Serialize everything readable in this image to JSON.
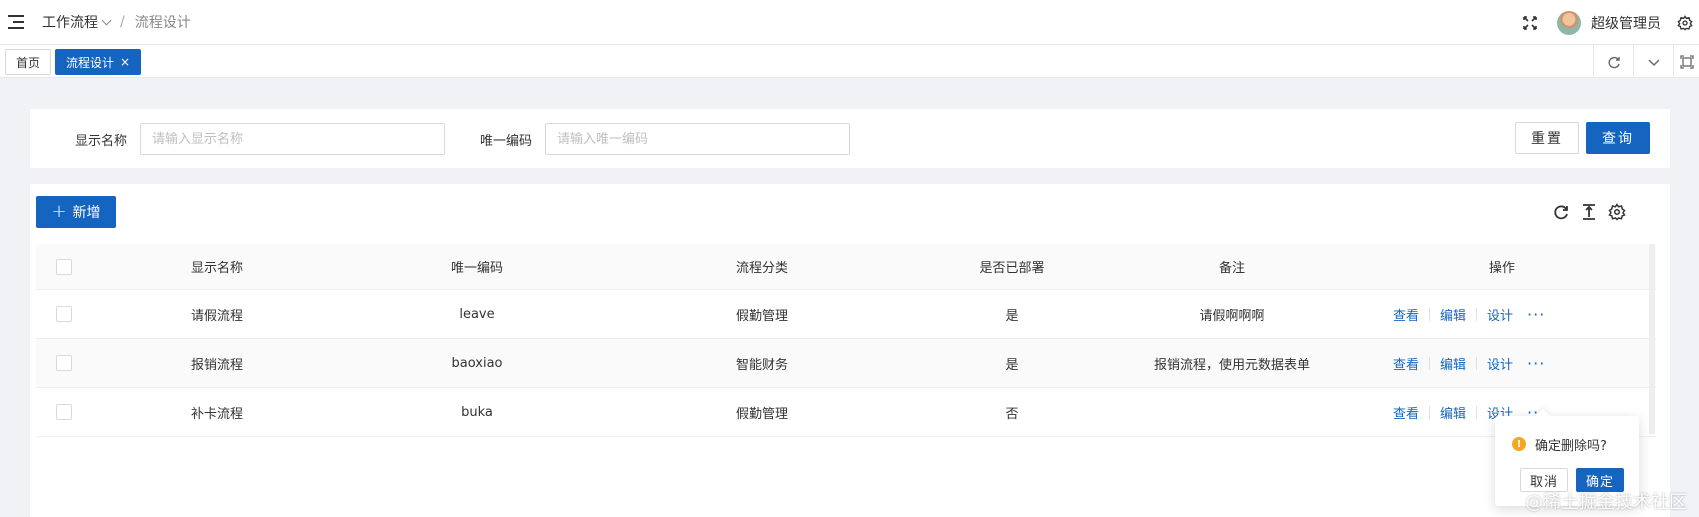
{
  "header": {
    "breadcrumb_parent": "工作流程",
    "breadcrumb_separator": "/",
    "breadcrumb_current": "流程设计",
    "username": "超级管理员"
  },
  "tabs": [
    {
      "label": "首页",
      "active": false
    },
    {
      "label": "流程设计",
      "active": true,
      "close": "×"
    }
  ],
  "search": {
    "name_label": "显示名称",
    "name_placeholder": "请输入显示名称",
    "code_label": "唯一编码",
    "code_placeholder": "请输入唯一编码",
    "reset_label": "重置",
    "query_label": "查询"
  },
  "toolbar": {
    "add_plus": "+",
    "add_label": "新增"
  },
  "table": {
    "columns": {
      "name": "显示名称",
      "code": "唯一编码",
      "category": "流程分类",
      "deployed": "是否已部署",
      "remark": "备注",
      "actions": "操作"
    },
    "action_labels": {
      "view": "查看",
      "edit": "编辑",
      "design": "设计",
      "more": "···"
    },
    "rows": [
      {
        "name": "请假流程",
        "code": "leave",
        "category": "假勤管理",
        "deployed": "是",
        "remark": "请假啊啊啊"
      },
      {
        "name": "报销流程",
        "code": "baoxiao",
        "category": "智能财务",
        "deployed": "是",
        "remark": "报销流程，使用元数据表单"
      },
      {
        "name": "补卡流程",
        "code": "buka",
        "category": "假勤管理",
        "deployed": "否",
        "remark": ""
      }
    ]
  },
  "popconfirm": {
    "icon": "!",
    "message": "确定删除吗?",
    "cancel_label": "取消",
    "ok_label": "确定"
  },
  "watermark": "@稀土掘金技术社区",
  "colors": {
    "primary": "#1565c0",
    "warning": "#f5a623"
  }
}
